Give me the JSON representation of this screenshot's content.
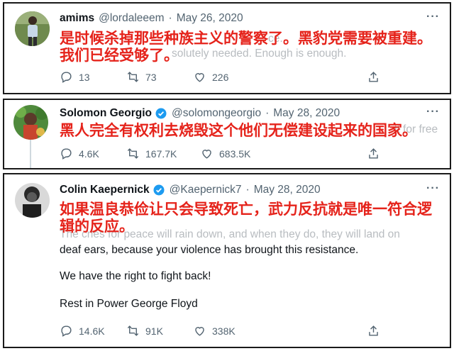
{
  "tweets": [
    {
      "name": "amims",
      "handle": "@lordaleeem",
      "date": "May 26, 2020",
      "ghost_text_1": "ce.",
      "ghost_text_2": "solutely needed. Enough is enough.",
      "overlay": "是时候杀掉那些种族主义的警察了。黑豹党需要被重建。我们已经受够了。",
      "replies": "13",
      "retweets": "73",
      "likes": "226"
    },
    {
      "name": "Solomon Georgio",
      "handle": "@solomongeorgio",
      "date": "May 28, 2020",
      "ghost_text_1": "lt for free",
      "overlay": "黑人完全有权利去烧毁这个他们无偿建设起来的国家。",
      "replies": "4.6K",
      "retweets": "167.7K",
      "likes": "683.5K"
    },
    {
      "name": "Colin Kaepernick",
      "handle": "@Kaepernick7",
      "date": "May 28, 2020",
      "overlay": "如果温良恭俭让只会导致死亡，武力反抗就是唯一符合逻辑的反应。",
      "ghost_text_1": "The cries for peace will rain down, and when they do, they will land on",
      "body_line_1": "deaf ears, because your violence has brought this resistance.",
      "body_line_2": "We have the right to fight back!",
      "body_line_3": "Rest in Power George Floyd",
      "replies": "14.6K",
      "retweets": "91K",
      "likes": "338K"
    }
  ],
  "separator": "·",
  "more_glyph": "···",
  "colors": {
    "overlay_red": "#e5231b",
    "verified_blue": "#1d9bf0",
    "meta_gray": "#536471"
  }
}
